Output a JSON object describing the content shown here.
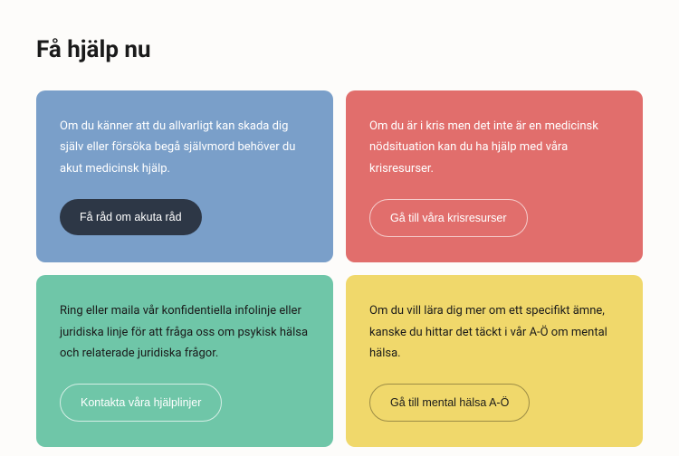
{
  "heading": "Få hjälp nu",
  "cards": [
    {
      "text": "Om du känner att du allvarligt kan skada dig själv eller försöka begå självmord behöver du akut medicinsk hjälp.",
      "button": "Få råd om akuta råd"
    },
    {
      "text": "Om du är i kris men det inte är en medicinsk nödsituation kan du ha hjälp med våra krisresurser.",
      "button": "Gå till våra krisresurser"
    },
    {
      "text": "Ring eller maila vår konfidentiella infolinje eller juridiska linje för att fråga oss om psykisk hälsa och relaterade juridiska frågor.",
      "button": "Kontakta våra hjälplinjer"
    },
    {
      "text": "Om du vill lära dig mer om ett specifikt ämne, kanske du hittar det täckt i vår A-Ö om mental hälsa.",
      "button": "Gå till mental hälsa A-Ö"
    }
  ]
}
